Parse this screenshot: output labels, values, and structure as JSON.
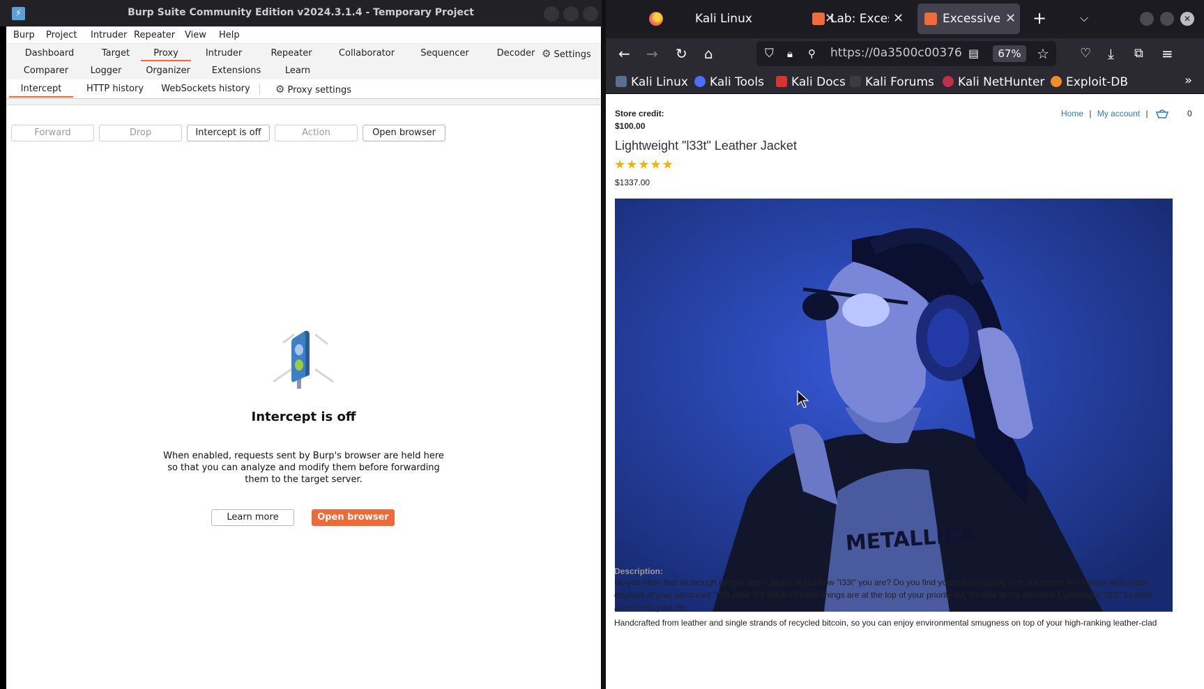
{
  "burp": {
    "title": "Burp Suite Community Edition v2024.3.1.4 - Temporary Project",
    "menu": [
      "Burp",
      "Project",
      "Intruder",
      "Repeater",
      "View",
      "Help"
    ],
    "tabs_row1": [
      "Dashboard",
      "Target",
      "Proxy",
      "Intruder",
      "Repeater",
      "Collaborator",
      "Sequencer",
      "Decoder"
    ],
    "settings_label": "Settings",
    "tabs_row2": [
      "Comparer",
      "Logger",
      "Organizer",
      "Extensions",
      "Learn"
    ],
    "subtabs": [
      "Intercept",
      "HTTP history",
      "WebSockets history"
    ],
    "proxy_settings_label": "Proxy settings",
    "toolbar": {
      "forward": "Forward",
      "drop": "Drop",
      "intercept": "Intercept is off",
      "action": "Action",
      "open_browser": "Open browser"
    },
    "panel": {
      "heading": "Intercept is off",
      "text_lines": [
        "When enabled, requests sent by Burp's browser are held here",
        "so that you can analyze and modify them before forwarding",
        "them to the target server."
      ],
      "learn_more": "Learn more",
      "open_browser": "Open browser"
    }
  },
  "browser": {
    "tabs": [
      {
        "label": "Kali Linux",
        "active": false
      },
      {
        "label": "Lab: Excessiv",
        "active": false
      },
      {
        "label": "Excessive tru",
        "active": true
      }
    ],
    "new_tab_icon": "plus-icon",
    "url": "https://0a3500c00376",
    "zoom": "67%",
    "bookmarks": [
      "Kali Linux",
      "Kali Tools",
      "Kali Docs",
      "Kali Forums",
      "Kali NetHunter",
      "Exploit-DB"
    ],
    "page": {
      "store_credit_label": "Store credit:",
      "store_credit_value": "$100.00",
      "nav_home": "Home",
      "nav_account": "My account",
      "nav_sep": "|",
      "cart_count": "0",
      "product_title": "Lightweight \"l33t\" Leather Jacket",
      "rating": 5,
      "price": "$1337.00",
      "image_caption_text": "METALLICA",
      "description_label": "Description:",
      "description_lines": [
        "Do you often feel as though people aren't aware of just how \"l33t\" you are? Do you find yourself struggling to make others feel inferior with public",
        "displays of your advanced \"l33t-ness\"? If either of these things are at the top of your priority list, it's time to the welcome Lightweight \"l33t\" Leather",
        "Jacket into your life."
      ],
      "description_line2": "Handcrafted from leather and single strands of recycled bitcoin, so you can enjoy environmental smugness on top of your high-ranking leather-clad"
    }
  },
  "colors": {
    "accent": "#ff6633",
    "primary_button": "#ef6a37",
    "link": "#2a7ec2",
    "star": "#f5b301"
  }
}
